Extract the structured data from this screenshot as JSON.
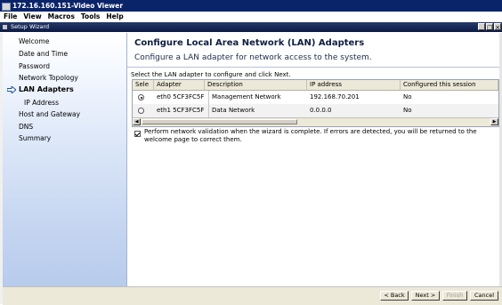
{
  "window": {
    "title": "172.16.160.151-Video Viewer"
  },
  "menubar": {
    "items": [
      "File",
      "View",
      "Macros",
      "Tools",
      "Help"
    ]
  },
  "wizard": {
    "title": "Setup Wizard"
  },
  "sidebar": {
    "items": [
      {
        "label": "Welcome"
      },
      {
        "label": "Date and Time"
      },
      {
        "label": "Password"
      },
      {
        "label": "Network Topology"
      },
      {
        "label": "LAN Adapters",
        "active": true
      },
      {
        "label": "IP Address",
        "sub": true
      },
      {
        "label": "Host and Gateway"
      },
      {
        "label": "DNS"
      },
      {
        "label": "Summary"
      }
    ]
  },
  "page": {
    "heading": "Configure Local Area Network (LAN) Adapters",
    "subheading": "Configure a LAN adapter for network access to the system.",
    "instruction": "Select the LAN adapter to configure and click Next."
  },
  "grid": {
    "columns": [
      "Sele",
      "Adapter",
      "Description",
      "IP address",
      "Configured this session"
    ],
    "rows": [
      {
        "selected": true,
        "adapter": "eth0 5CF3FC5F",
        "description": "Management Network",
        "ip": "192.168.70.201",
        "configured": "No"
      },
      {
        "selected": false,
        "adapter": "eth1 5CF3FC5F",
        "description": "Data Network",
        "ip": "0.0.0.0",
        "configured": "No"
      }
    ]
  },
  "validation": {
    "checked": true,
    "label": "Perform network validation when the wizard is complete. If errors are detected, you will be returned to the welcome page to correct them."
  },
  "footer": {
    "back": "< Back",
    "next": "Next >",
    "finish": "Finish",
    "cancel": "Cancel"
  },
  "colors": {
    "title_bar": "#0a246a",
    "sidebar_bottom": "#b7cbec",
    "heading": "#0d1e3f"
  }
}
